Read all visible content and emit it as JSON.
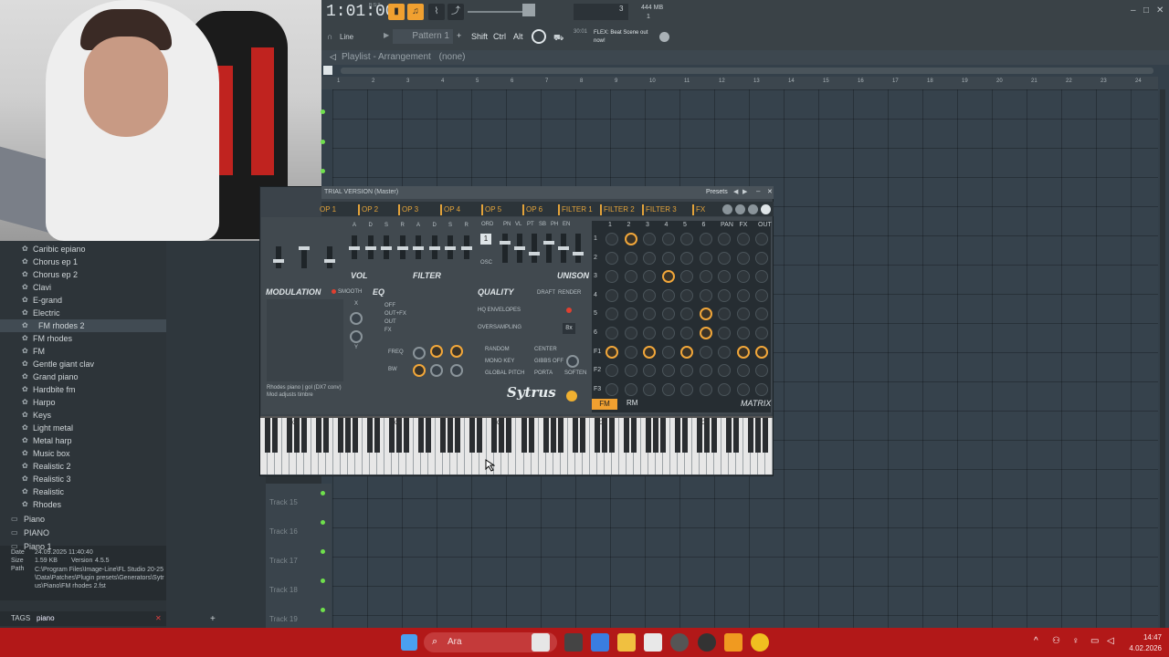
{
  "transport": {
    "time": "1:01:00",
    "time_superscript": "B:S:T",
    "tempo_counter": "3",
    "memory": "444 MB",
    "cpu_counter": "1"
  },
  "toolbar": {
    "snap": "Line",
    "pattern": "Pattern 1",
    "shift": "Shift",
    "ctrl": "Ctrl",
    "alt": "Alt",
    "news_time": "30:01",
    "news_text": "FLEX: Beat Scene out now!"
  },
  "playlist": {
    "title": "Playlist - Arrangement",
    "subtitle": "(none)",
    "ruler": [
      "1",
      "2",
      "3",
      "4",
      "5",
      "6",
      "7",
      "8",
      "9",
      "10",
      "11",
      "12",
      "13",
      "14",
      "15",
      "16",
      "17",
      "18",
      "19",
      "20",
      "21",
      "22",
      "23",
      "24"
    ],
    "tracks": [
      "Track 15",
      "Track 16",
      "Track 17",
      "Track 18",
      "Track 19"
    ]
  },
  "browser": {
    "items": [
      {
        "label": "Caribic epiano",
        "type": "preset"
      },
      {
        "label": "Chorus ep 1",
        "type": "preset"
      },
      {
        "label": "Chorus ep 2",
        "type": "preset"
      },
      {
        "label": "Clavi",
        "type": "preset"
      },
      {
        "label": "E-grand",
        "type": "preset"
      },
      {
        "label": "Electric",
        "type": "preset"
      },
      {
        "label": "FM rhodes 2",
        "type": "preset",
        "selected": true
      },
      {
        "label": "FM rhodes",
        "type": "preset"
      },
      {
        "label": "FM",
        "type": "preset"
      },
      {
        "label": "Gentle giant clav",
        "type": "preset"
      },
      {
        "label": "Grand piano",
        "type": "preset"
      },
      {
        "label": "Hardbite fm",
        "type": "preset"
      },
      {
        "label": "Harpo",
        "type": "preset"
      },
      {
        "label": "Keys",
        "type": "preset"
      },
      {
        "label": "Light metal",
        "type": "preset"
      },
      {
        "label": "Metal harp",
        "type": "preset"
      },
      {
        "label": "Music box",
        "type": "preset"
      },
      {
        "label": "Realistic 2",
        "type": "preset"
      },
      {
        "label": "Realistic 3",
        "type": "preset"
      },
      {
        "label": "Realistic",
        "type": "preset"
      },
      {
        "label": "Rhodes",
        "type": "preset"
      },
      {
        "label": "Piano",
        "type": "folder"
      },
      {
        "label": "PIANO",
        "type": "folder"
      },
      {
        "label": "Piano 1",
        "type": "folder"
      }
    ],
    "info": {
      "date_label": "Date",
      "date": "24.09.2025 11:40:40",
      "size_label": "Size",
      "size": "1.59 KB",
      "version_label": "Version",
      "version": "4.5.5",
      "path_label": "Path",
      "path": "C:\\Program Files\\Image-Line\\FL Studio 20-25\\Data\\Patches\\Plugin presets\\Generators\\Sytrus\\Piano\\FM rhodes 2.fst"
    },
    "tags_label": "TAGS",
    "tags_value": "piano"
  },
  "sytrus": {
    "title": "TRIAL VERSION (Master)",
    "presets": "Presets",
    "tabs": [
      "OP 1",
      "OP 2",
      "OP 3",
      "OP 4",
      "OP 5",
      "OP 6",
      "FILTER 1",
      "FILTER 2",
      "FILTER 3",
      "FX"
    ],
    "env_labels": [
      "A",
      "D",
      "S",
      "R",
      "A",
      "D",
      "S",
      "R"
    ],
    "ord_labels": [
      "ORD",
      "PN",
      "VL",
      "PT",
      "SB",
      "PH",
      "EN"
    ],
    "ord_value": "1",
    "osc": "OSC",
    "vol": "VOL",
    "filter": "FILTER",
    "unison": "UNISON",
    "modulation": "MODULATION",
    "smooth": "SMOOTH",
    "mod_x": "X",
    "mod_y": "Y",
    "eq": "EQ",
    "eq_modes": [
      "OFF",
      "OUT+FX",
      "OUT",
      "FX"
    ],
    "freq": "FREQ",
    "bw": "BW",
    "quality": "QUALITY",
    "draft": "DRAFT",
    "render": "RENDER",
    "hq_env": "HQ ENVELOPES",
    "oversampling": "OVERSAMPLING",
    "oversampling_val": "8x",
    "options": [
      "RANDOM",
      "MONO KEY",
      "GLOBAL PITCH"
    ],
    "options2": [
      "CENTER",
      "GIBBS OFF",
      "PORTA"
    ],
    "soften": "SOFTEN",
    "desc_line1": "Rhodes piano   | gol (DX7 conv)",
    "desc_line2": "Mod adjusts timbre",
    "logo": "Sytrus",
    "matrix_cols": [
      "1",
      "2",
      "3",
      "4",
      "5",
      "6",
      "PAN",
      "FX",
      "OUT"
    ],
    "matrix_rows": [
      "1",
      "2",
      "3",
      "4",
      "5",
      "6",
      "F1",
      "F2",
      "F3"
    ],
    "fm": "FM",
    "rm": "RM",
    "matrix": "MATRIX",
    "octaves": [
      "C3",
      "C4",
      "C5",
      "C6",
      "C7"
    ]
  },
  "taskbar": {
    "search": "Ara",
    "time": "14:47",
    "date": "4.02.2026"
  }
}
